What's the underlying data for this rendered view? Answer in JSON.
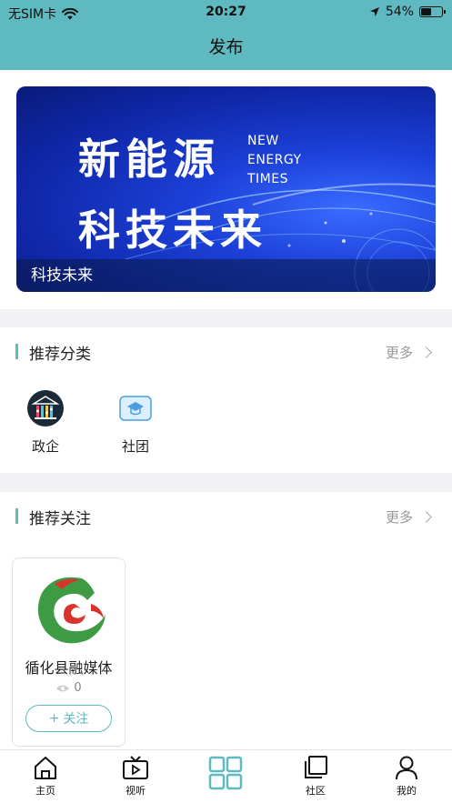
{
  "status_bar": {
    "carrier": "无SIM卡",
    "time": "20:27",
    "battery": "54%",
    "battery_level": 0.54
  },
  "header": {
    "title": "发布"
  },
  "banner": {
    "headline_1": "新能源",
    "headline_2": "科技未来",
    "english_1": "NEW",
    "english_2": "ENERGY",
    "english_3": "TIMES",
    "caption": "科技未来"
  },
  "recommended_categories": {
    "title": "推荐分类",
    "more_label": "更多",
    "items": [
      {
        "label": "政企",
        "icon": "government-building-icon"
      },
      {
        "label": "社团",
        "icon": "graduation-cap-icon"
      }
    ]
  },
  "recommended_follows": {
    "title": "推荐关注",
    "more_label": "更多",
    "items": [
      {
        "name": "循化县融媒体",
        "views": "0",
        "follow_label": "关注"
      }
    ]
  },
  "tabbar": {
    "items": [
      {
        "label": "主页",
        "icon": "home-icon"
      },
      {
        "label": "视听",
        "icon": "video-icon"
      },
      {
        "label": "",
        "icon": "grid-icon"
      },
      {
        "label": "社区",
        "icon": "community-icon"
      },
      {
        "label": "我的",
        "icon": "user-icon"
      }
    ]
  },
  "colors": {
    "accent": "#5fb9c1",
    "banner_blue": "#1b3fd6"
  }
}
